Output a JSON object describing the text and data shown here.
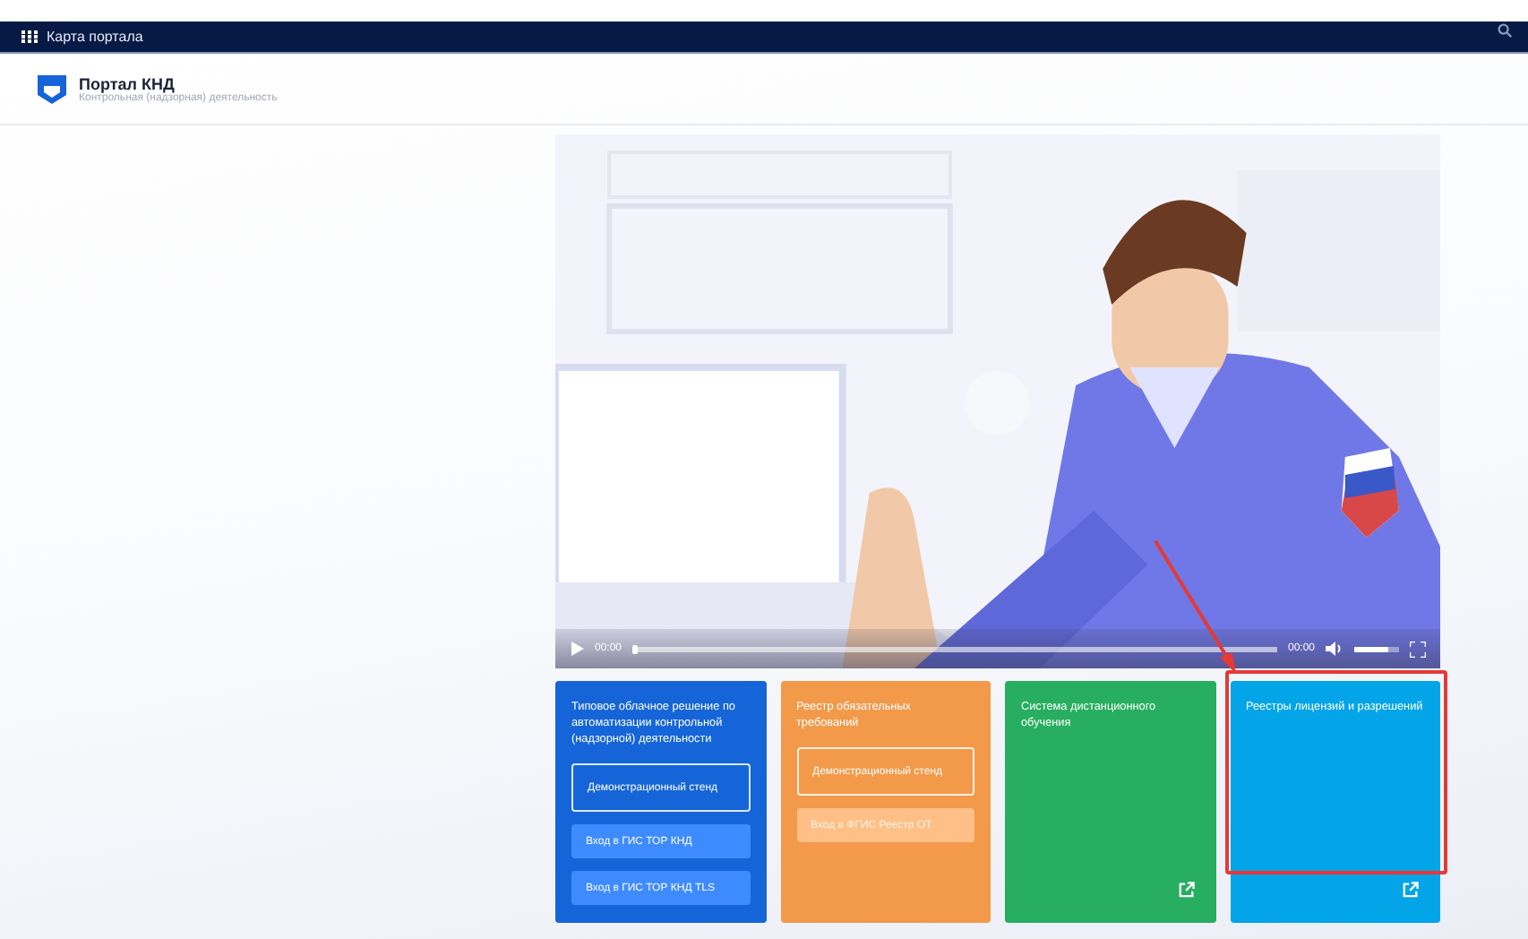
{
  "topbar": {
    "menu_label": "Карта портала"
  },
  "header": {
    "title": "Портал КНД",
    "subtitle": "Контрольная (надзорная) деятельность"
  },
  "video": {
    "current_time": "00:00",
    "duration": "00:00",
    "progress": {
      "level": 0
    },
    "volume": {
      "level": 0.75
    }
  },
  "cards": [
    {
      "title": "Типовое облачное решение по автоматизации контрольной (надзорной) деятельности",
      "color": "#1565d8",
      "external_link": false,
      "highlighted": false,
      "buttons": [
        {
          "label": "Демонстрационный стенд",
          "kind": "outline",
          "disabled": false
        },
        {
          "label": "Вход в ГИС ТОР КНД",
          "kind": "filled",
          "disabled": false
        },
        {
          "label": "Вход в ГИС ТОР КНД TLS",
          "kind": "filled",
          "disabled": false
        }
      ]
    },
    {
      "title": "Реестр обязательных требований",
      "color": "#f2994a",
      "external_link": false,
      "highlighted": false,
      "buttons": [
        {
          "label": "Демонстрационный стенд",
          "kind": "outline",
          "disabled": false
        },
        {
          "label": "Вход в ФГИС Реестр ОТ",
          "kind": "filled",
          "disabled": true
        }
      ]
    },
    {
      "title": "Система дистанционного обучения",
      "color": "#27ae60",
      "external_link": true,
      "highlighted": false
    },
    {
      "title": "Реестры лицензий и разрешений",
      "color": "#03a4e8",
      "external_link": true,
      "highlighted": true
    }
  ]
}
